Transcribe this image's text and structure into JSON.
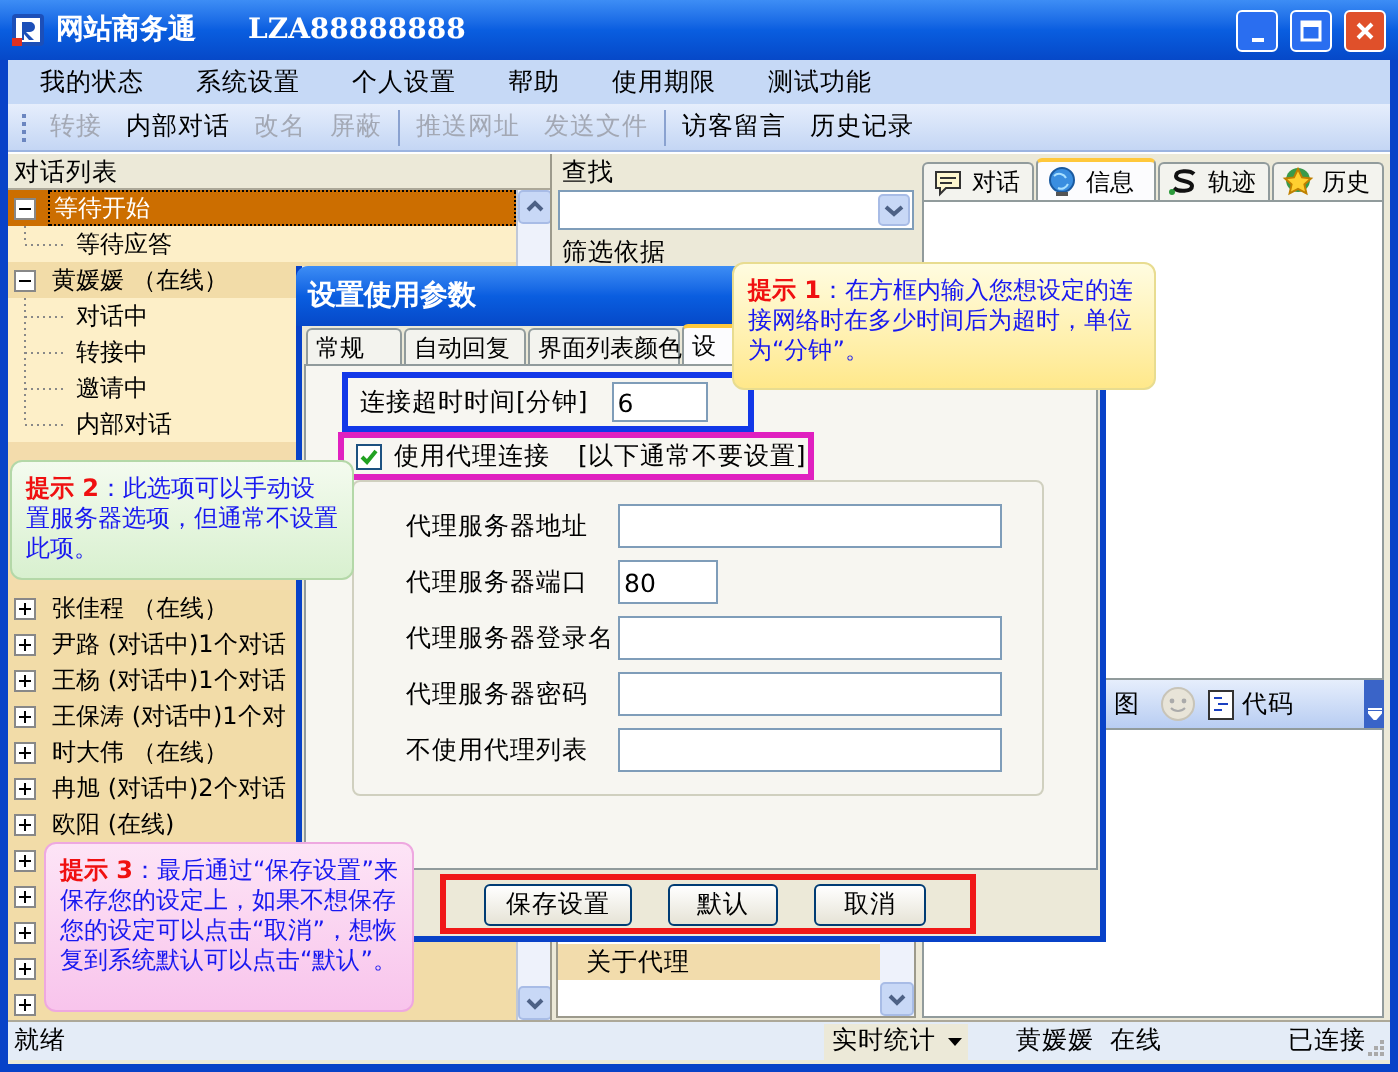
{
  "window": {
    "title": "网站商务通",
    "account": "LZA88888888"
  },
  "menu": [
    "我的状态",
    "系统设置",
    "个人设置",
    "帮助",
    "使用期限",
    "测试功能"
  ],
  "toolbar": [
    {
      "kind": "button",
      "label": "转接",
      "disabled": true
    },
    {
      "kind": "button",
      "label": "内部对话",
      "disabled": false
    },
    {
      "kind": "button",
      "label": "改名",
      "disabled": true
    },
    {
      "kind": "button",
      "label": "屏蔽",
      "disabled": true
    },
    {
      "kind": "separator"
    },
    {
      "kind": "button",
      "label": "推送网址",
      "disabled": true
    },
    {
      "kind": "button",
      "label": "发送文件",
      "disabled": true
    },
    {
      "kind": "separator"
    },
    {
      "kind": "button",
      "label": "访客留言",
      "disabled": false
    },
    {
      "kind": "button",
      "label": "历史记录",
      "disabled": false
    }
  ],
  "conversation_list": {
    "title": "对话列表",
    "groups": [
      {
        "label": "等待开始",
        "expanded": true,
        "selected": true,
        "children": [
          {
            "label": "等待应答"
          }
        ]
      },
      {
        "label": "黄媛媛 （在线）",
        "expanded": true,
        "selected": false,
        "children": [
          {
            "label": "对话中"
          },
          {
            "label": "转接中"
          },
          {
            "label": "邀请中"
          },
          {
            "label": "内部对话"
          }
        ]
      },
      {
        "label": "张佳程 （在线）",
        "expanded": false,
        "selected": false
      },
      {
        "label": "尹路 (对话中)1个对话",
        "expanded": false,
        "selected": false
      },
      {
        "label": "王杨 (对话中)1个对话",
        "expanded": false,
        "selected": false
      },
      {
        "label": "王保涛 (对话中)1个对",
        "expanded": false,
        "selected": false
      },
      {
        "label": "时大伟 （在线）",
        "expanded": false,
        "selected": false
      },
      {
        "label": "冉旭 (对话中)2个对话",
        "expanded": false,
        "selected": false
      },
      {
        "label": "欧阳 (在线)",
        "expanded": false,
        "selected": false
      },
      {
        "expanded": false,
        "selected": false
      },
      {
        "expanded": false,
        "selected": false
      },
      {
        "expanded": false,
        "selected": false
      },
      {
        "expanded": false,
        "selected": false
      },
      {
        "expanded": false,
        "selected": false
      }
    ]
  },
  "search_pane": {
    "search_label": "查找",
    "filter_label": "筛选依据",
    "list": [
      {
        "label": "关于代理",
        "selected": true
      }
    ]
  },
  "info_pane": {
    "tabs": [
      {
        "label": "对话",
        "selected": false
      },
      {
        "label": "信息",
        "selected": true
      },
      {
        "label": "轨迹",
        "selected": false
      },
      {
        "label": "历史",
        "selected": false
      }
    ],
    "tools": [
      {
        "kind": "text",
        "label": "图"
      },
      {
        "kind": "smiley"
      },
      {
        "kind": "code",
        "label": "代码"
      }
    ]
  },
  "dialog": {
    "title": "设置使用参数",
    "tabs": [
      {
        "label": "常规",
        "selected": false
      },
      {
        "label": "自动回复",
        "selected": false
      },
      {
        "label": "界面列表颜色",
        "selected": false
      },
      {
        "label": "设",
        "selected": true
      }
    ],
    "timeout": {
      "label": "连接超时时间[分钟]",
      "value": "6"
    },
    "proxy": {
      "label": "使用代理连接",
      "note": "[以下通常不要设置]",
      "checked": true
    },
    "fields": [
      {
        "label": "代理服务器地址",
        "short": false
      },
      {
        "label": "代理服务器端口",
        "value": "80",
        "short": true
      },
      {
        "label": "代理服务器登录名",
        "short": false
      },
      {
        "label": "代理服务器密码",
        "short": false
      },
      {
        "label": "不使用代理列表",
        "short": false
      }
    ],
    "buttons": [
      "保存设置",
      "默认",
      "取消"
    ]
  },
  "callouts": [
    {
      "kind": "yellow",
      "text": "**提示 1**：在方框内输入您想设定的连接网络时在多少时间后为超时，单位为“分钟”。"
    },
    {
      "kind": "green",
      "text": "**提示 2**：此选项可以手动设置服务器选项，但通常不设置此项。"
    },
    {
      "kind": "pink",
      "text": "**提示 3**：最后通过“保存设置”来保存您的设定上，如果不想保存您的设定可以点击“取消”，想恢复到系统默认可以点击“默认”。"
    }
  ],
  "status_bar": {
    "state": "就绪",
    "stats": "实时统计",
    "user": "黄媛媛  在线",
    "connection": "已连接"
  }
}
